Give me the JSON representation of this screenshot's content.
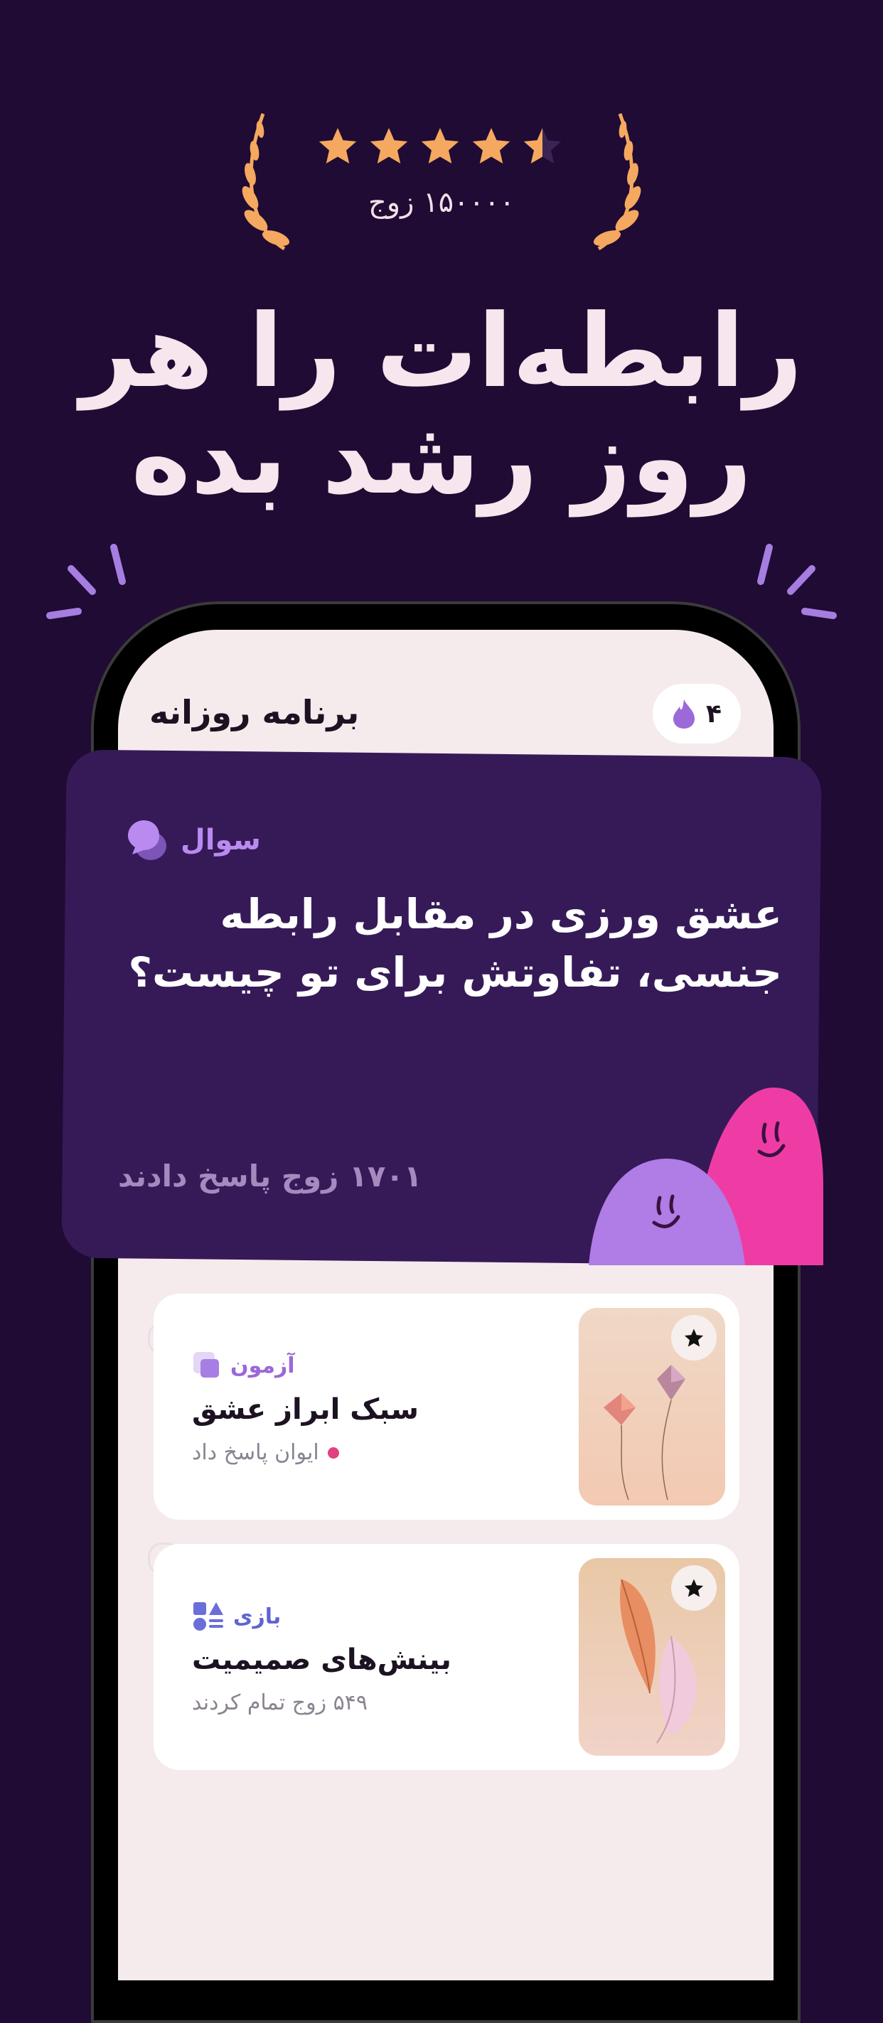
{
  "hero": {
    "rating_value": 4.5,
    "rating_count": "۱۵۰۰۰۰ زوج",
    "headline_line1": "رابطه‌ات را هر",
    "headline_line2": "روز رشد بده"
  },
  "colors": {
    "background": "#1f0b33",
    "star": "#f5a85f",
    "card": "#361a58",
    "accent_purple": "#b98bf0",
    "accent_pink": "#ef3ca5"
  },
  "app": {
    "title": "برنامه روزانه",
    "streak": "۴",
    "streak_icon": "flame-icon"
  },
  "question_card": {
    "tag": "سوال",
    "tag_icon": "chat-bubbles-icon",
    "question": "عشق ورزی در مقابل رابطه جنسی، تفاوتش برای تو چیست؟",
    "answers": "۱۷۰۱ زوج پاسخ دادند"
  },
  "activities": [
    {
      "category": "آزمون",
      "category_icon": "quiz-icon",
      "title": "سبک ابراز عشق",
      "meta": "ایوان پاسخ داد",
      "thumb": "kites-image",
      "favorite_icon": "star-icon"
    },
    {
      "category": "بازی",
      "category_icon": "shapes-icon",
      "title": "بینش‌های صمیمیت",
      "meta": "۵۴۹ زوج تمام کردند",
      "thumb": "feathers-image",
      "favorite_icon": "star-icon"
    }
  ]
}
